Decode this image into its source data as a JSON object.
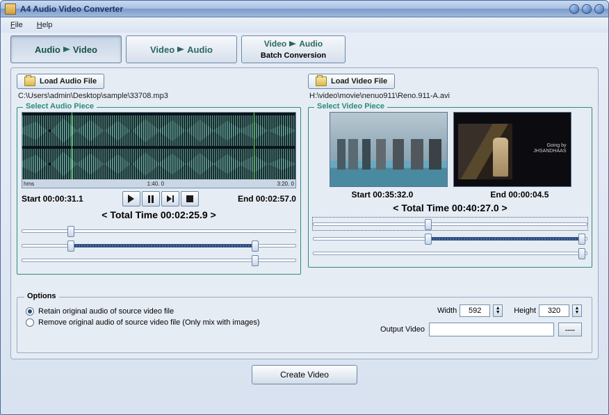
{
  "title": "A4 Audio Video Converter",
  "menu": {
    "file": "File",
    "help": "Help"
  },
  "tabs": {
    "audio_video_a": "Audio",
    "audio_video_b": "Video",
    "video_audio_a": "Video",
    "video_audio_b": "Audio",
    "batch_a": "Video",
    "batch_b": "Audio",
    "batch_sub": "Batch Conversion"
  },
  "audio": {
    "load_btn": "Load Audio File",
    "path": "C:\\Users\\admin\\Desktop\\sample\\33708.mp3",
    "legend": "Select Audio Piece",
    "ruler": {
      "a": "hms",
      "b": "1:40. 0",
      "c": "3:20. 0"
    },
    "start": "Start 00:00:31.1",
    "end": "End 00:02:57.0",
    "total": "< Total Time 00:02:25.9 >"
  },
  "video": {
    "load_btn": "Load Video File",
    "path": "H:\\video\\movie\\nenuo911\\Reno.911-A.avi",
    "legend": "Select Video Piece",
    "start": "Start 00:35:32.0",
    "end": "End 00:00:04.5",
    "total": "< Total Time 00:40:27.0 >",
    "caption1": "Going by",
    "caption2": "JHSANDHAAS"
  },
  "options": {
    "legend": "Options",
    "retain": "Retain original audio of source video file",
    "remove": "Remove original audio of source video file (Only mix with images)",
    "width_label": "Width",
    "width_val": "592",
    "height_label": "Height",
    "height_val": "320",
    "output_label": "Output Video",
    "browse": "....."
  },
  "create": "Create Video"
}
